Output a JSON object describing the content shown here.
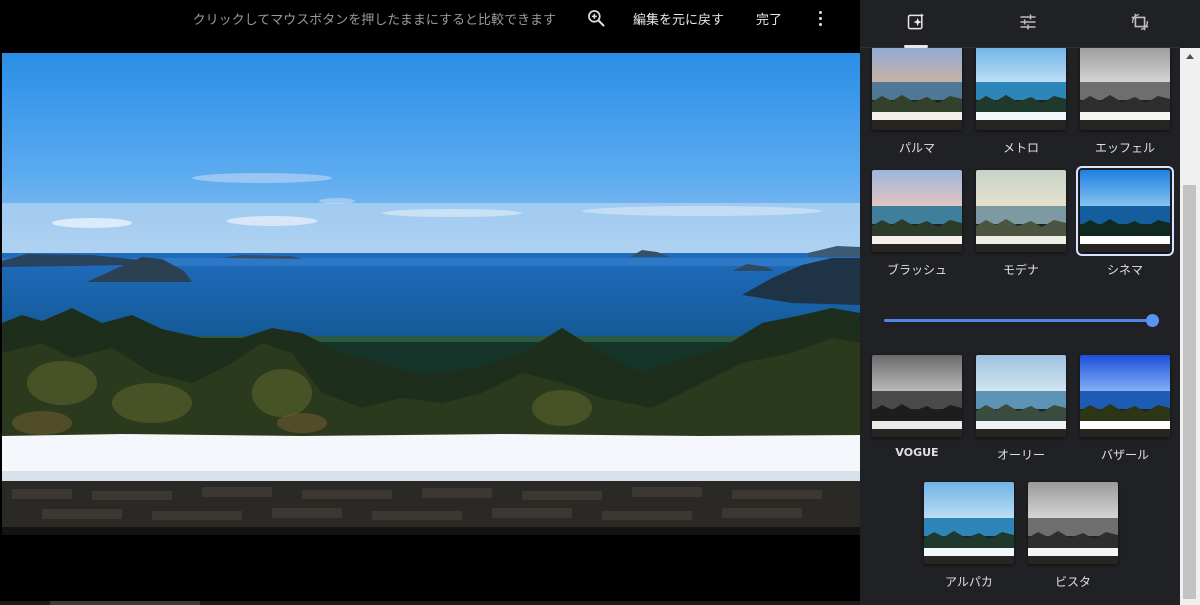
{
  "toolbar": {
    "compare_hint": "クリックしてマウスボタンを押したままにすると比較できます",
    "zoom_icon": "zoom-in-icon",
    "revert_label": "編集を元に戻す",
    "done_label": "完了",
    "more_icon": "more-vert-icon"
  },
  "panel": {
    "tabs": [
      {
        "name": "filters",
        "icon": "auto-fix-icon",
        "active": true
      },
      {
        "name": "adjust",
        "icon": "tune-icon",
        "active": false
      },
      {
        "name": "crop-rotate",
        "icon": "crop-rotate-icon",
        "active": false
      }
    ],
    "filters": [
      {
        "label": "パルマ",
        "style": "warm"
      },
      {
        "label": "メトロ",
        "style": "cool"
      },
      {
        "label": "エッフェル",
        "style": "mono"
      },
      {
        "label": "ブラッシュ",
        "style": "blush"
      },
      {
        "label": "モデナ",
        "style": "faded"
      },
      {
        "label": "シネマ",
        "style": "cinema",
        "selected": true
      },
      {
        "label": "VOGUE",
        "style": "mono-dark"
      },
      {
        "label": "オーリー",
        "style": "cool-faded"
      },
      {
        "label": "バザール",
        "style": "vivid"
      },
      {
        "label": "アルパカ",
        "style": "cool"
      },
      {
        "label": "ビスタ",
        "style": "mono"
      }
    ],
    "intensity": 1.0
  },
  "colors": {
    "accent": "#4f86e8",
    "panel_bg": "#202124",
    "sky_top": "#2a8ee6",
    "sea": "#1a70c8"
  }
}
